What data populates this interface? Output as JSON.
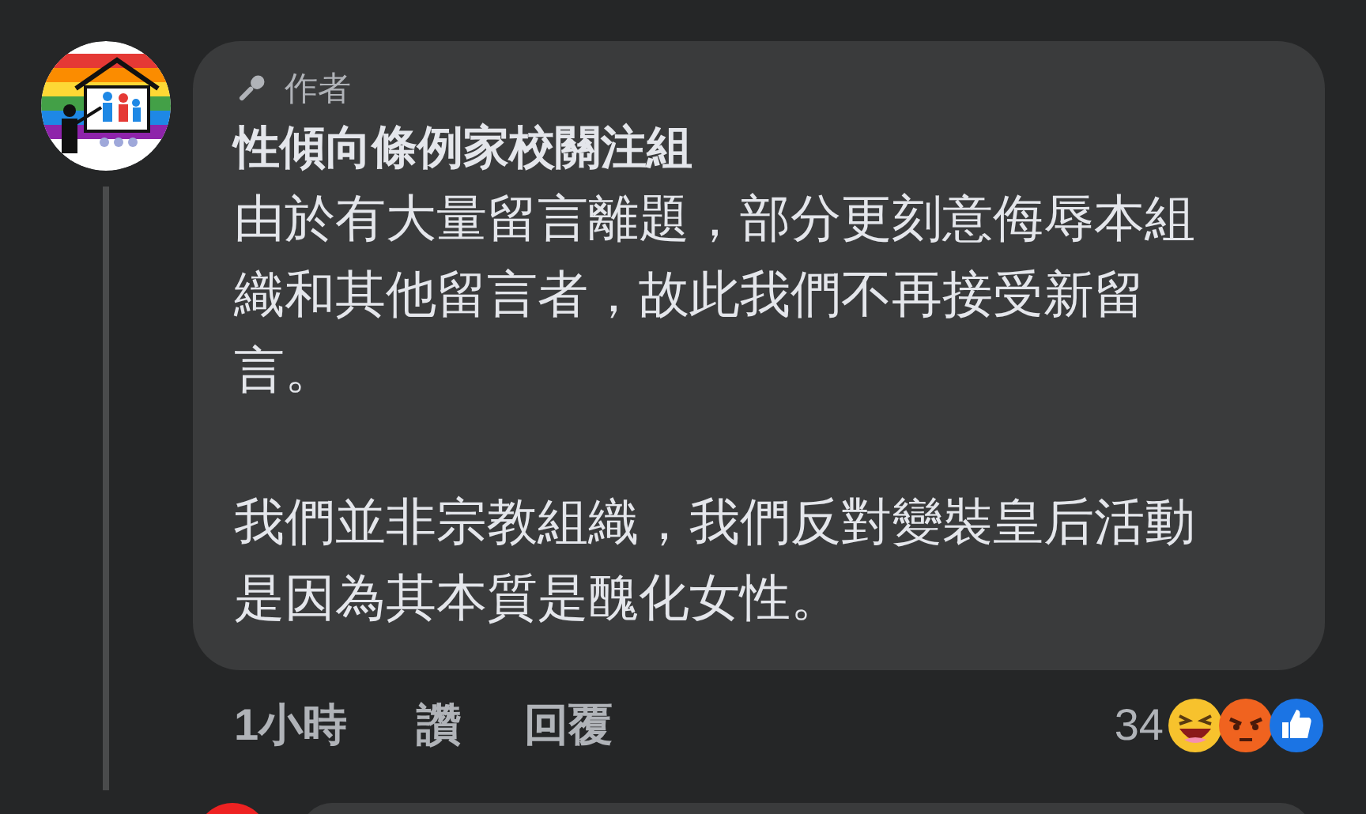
{
  "comment": {
    "badge": "作者",
    "author": "性傾向條例家校關注組",
    "paragraphs": [
      "由於有大量留言離題，部分更刻意侮辱本組織和其他留言者，故此我們不再接受新留言。",
      "我們並非宗教組織，我們反對變裝皇后活動是因為其本質是醜化女性。"
    ],
    "time": "1小時",
    "actions": [
      "讚",
      "回覆"
    ],
    "reaction_count": "34"
  }
}
